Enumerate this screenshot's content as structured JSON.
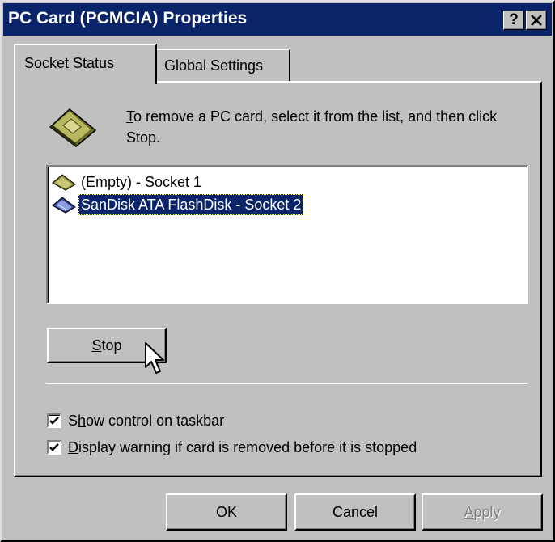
{
  "window": {
    "title": "PC Card (PCMCIA) Properties",
    "help_button": "?",
    "close_button": "✕"
  },
  "tabs": [
    {
      "label": "Socket Status",
      "selected": true
    },
    {
      "label": "Global Settings",
      "selected": false
    }
  ],
  "instruction": {
    "mnemonic": "T",
    "text": "o remove a PC card, select it from the list, and then click Stop."
  },
  "sockets": [
    {
      "label": "(Empty) - Socket 1",
      "icon": "empty-card-icon",
      "selected": false
    },
    {
      "label": "SanDisk ATA FlashDisk - Socket 2",
      "icon": "flash-card-icon",
      "selected": true
    }
  ],
  "stop_button": {
    "mnemonic": "S",
    "rest": "top"
  },
  "options": [
    {
      "pre": "S",
      "mnemonic": "h",
      "rest": "ow control on taskbar",
      "checked": true
    },
    {
      "pre": "",
      "mnemonic": "D",
      "rest": "isplay warning if card is removed before it is stopped",
      "checked": true
    }
  ],
  "buttons": {
    "ok": "OK",
    "cancel": "Cancel",
    "apply": {
      "mnemonic": "A",
      "rest": "pply",
      "enabled": false
    }
  },
  "colors": {
    "titlebar": "#0a246a",
    "face": "#c0c0c0",
    "selection": "#0a246a"
  }
}
